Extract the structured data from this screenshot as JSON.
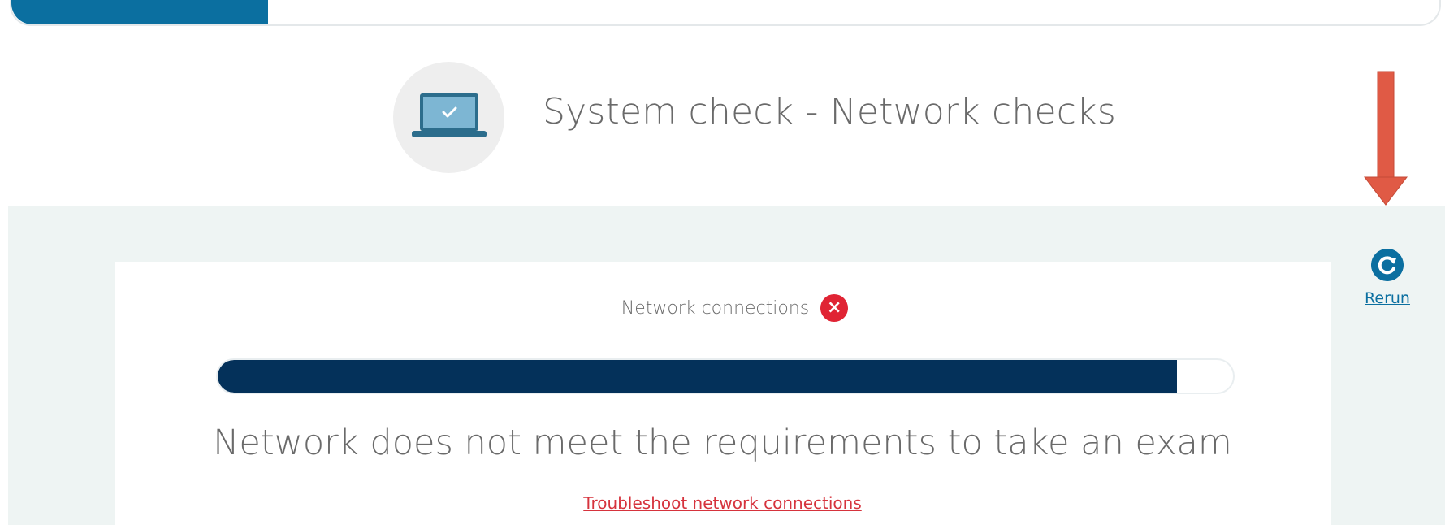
{
  "step_progress": {
    "value_fraction": 0.18
  },
  "header": {
    "title": "System check - Network checks",
    "icon": "laptop-check-icon"
  },
  "annotation": {
    "icon": "red-down-arrow",
    "color": "#e05a45"
  },
  "check": {
    "label": "Network connections",
    "status_icon": "error-x-icon",
    "status_color": "#e02434",
    "progress_fraction": 0.945,
    "message": "Network does not meet the requirements to take an exam",
    "link_label": "Troubleshoot network connections"
  },
  "rerun": {
    "label": "Rerun",
    "icon": "refresh-icon"
  },
  "colors": {
    "accent": "#0b6fa0",
    "bar_fill": "#04315a",
    "panel_bg": "#eef4f3",
    "link": "#d6333d"
  }
}
